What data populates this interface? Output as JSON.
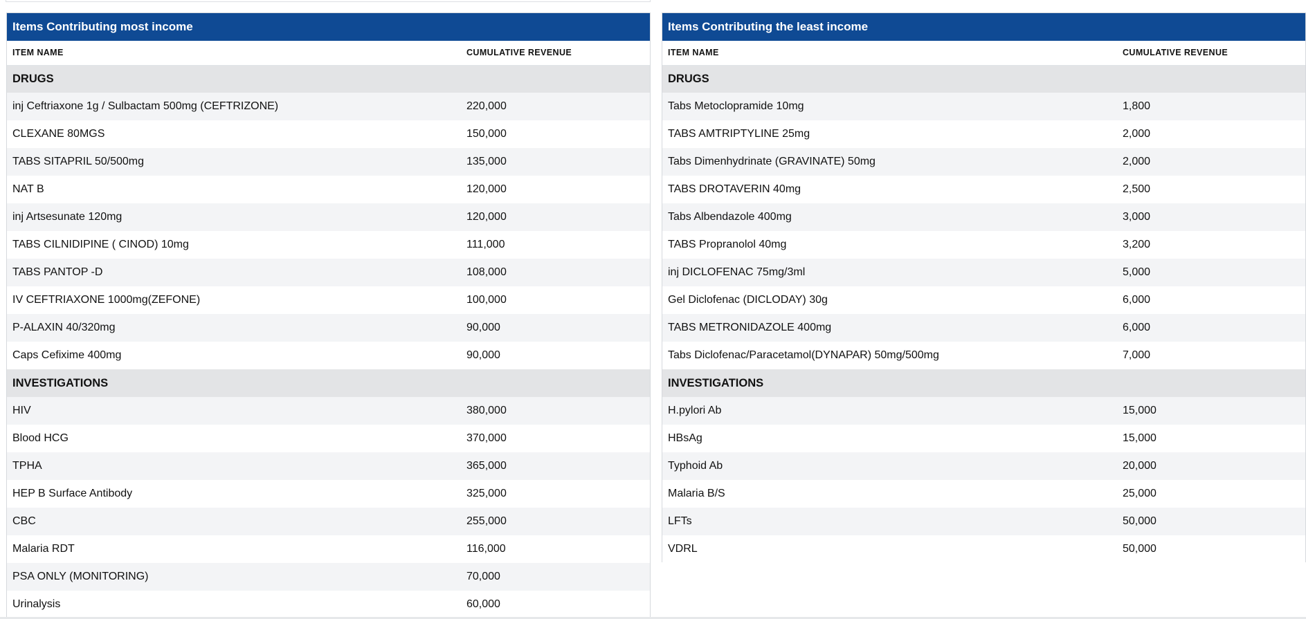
{
  "panels": [
    {
      "title": "Items Contributing most income",
      "columns": [
        "ITEM NAME",
        "CUMULATIVE REVENUE"
      ],
      "groups": [
        {
          "name": "DRUGS",
          "rows": [
            [
              "inj Ceftriaxone 1g / Sulbactam 500mg (CEFTRIZONE)",
              "220,000"
            ],
            [
              "CLEXANE 80MGS",
              "150,000"
            ],
            [
              "TABS SITAPRIL 50/500mg",
              "135,000"
            ],
            [
              "NAT B",
              "120,000"
            ],
            [
              "inj Artsesunate 120mg",
              "120,000"
            ],
            [
              "TABS CILNIDIPINE ( CINOD) 10mg",
              "111,000"
            ],
            [
              "TABS PANTOP -D",
              "108,000"
            ],
            [
              "IV CEFTRIAXONE 1000mg(ZEFONE)",
              "100,000"
            ],
            [
              "P-ALAXIN 40/320mg",
              "90,000"
            ],
            [
              "Caps Cefixime 400mg",
              "90,000"
            ]
          ]
        },
        {
          "name": "INVESTIGATIONS",
          "rows": [
            [
              "HIV",
              "380,000"
            ],
            [
              "Blood HCG",
              "370,000"
            ],
            [
              "TPHA",
              "365,000"
            ],
            [
              "HEP B Surface Antibody",
              "325,000"
            ],
            [
              "CBC",
              "255,000"
            ],
            [
              "Malaria RDT",
              "116,000"
            ],
            [
              "PSA ONLY (MONITORING)",
              "70,000"
            ],
            [
              "Urinalysis",
              "60,000"
            ]
          ]
        }
      ]
    },
    {
      "title": "Items Contributing the least income",
      "columns": [
        "ITEM NAME",
        "CUMULATIVE REVENUE"
      ],
      "groups": [
        {
          "name": "DRUGS",
          "rows": [
            [
              "Tabs Metoclopramide 10mg",
              "1,800"
            ],
            [
              "TABS AMTRIPTYLINE 25mg",
              "2,000"
            ],
            [
              "Tabs Dimenhydrinate (GRAVINATE) 50mg",
              "2,000"
            ],
            [
              "TABS DROTAVERIN 40mg",
              "2,500"
            ],
            [
              "Tabs Albendazole 400mg",
              "3,000"
            ],
            [
              "TABS Propranolol 40mg",
              "3,200"
            ],
            [
              "inj DICLOFENAC 75mg/3ml",
              "5,000"
            ],
            [
              "Gel Diclofenac (DICLODAY) 30g",
              "6,000"
            ],
            [
              "TABS METRONIDAZOLE 400mg",
              "6,000"
            ],
            [
              "Tabs Diclofenac/Paracetamol(DYNAPAR) 50mg/500mg",
              "7,000"
            ]
          ]
        },
        {
          "name": "INVESTIGATIONS",
          "rows": [
            [
              "H.pylori Ab",
              "15,000"
            ],
            [
              "HBsAg",
              "15,000"
            ],
            [
              "Typhoid Ab",
              "20,000"
            ],
            [
              "Malaria B/S",
              "25,000"
            ],
            [
              "LFTs",
              "50,000"
            ],
            [
              "VDRL",
              "50,000"
            ]
          ]
        }
      ]
    }
  ],
  "colors": {
    "header_bg": "#0f4a94",
    "group_bg": "#e3e4e6",
    "row_alt_bg": "#f3f4f6"
  }
}
